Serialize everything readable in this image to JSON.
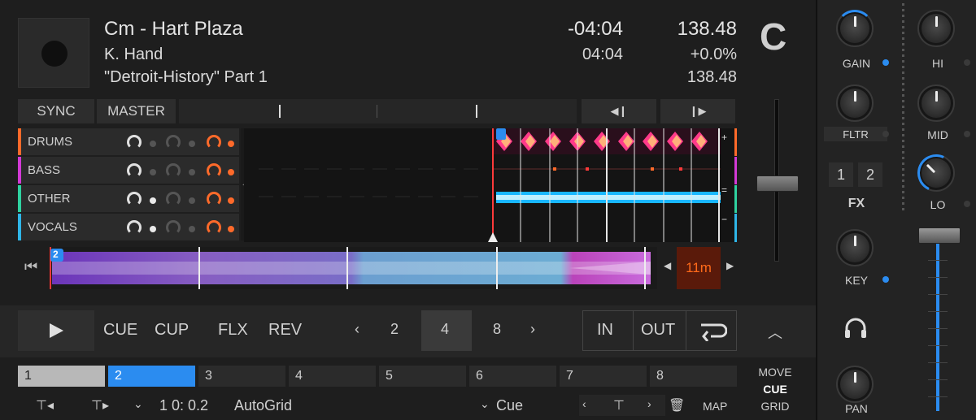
{
  "track": {
    "title": "Cm - Hart Plaza",
    "artist": "K. Hand",
    "album": "\"Detroit-History\" Part 1",
    "remaining": "-04:04",
    "length": "04:04",
    "bpm": "138.48",
    "pitch": "+0.0%",
    "bpm_base": "138.48",
    "deck_letter": "C"
  },
  "sync_row": {
    "sync": "SYNC",
    "master": "MASTER"
  },
  "stems": [
    {
      "label": "DRUMS",
      "color": "#ff6a2a"
    },
    {
      "label": "BASS",
      "color": "#d33ad6"
    },
    {
      "label": "OTHER",
      "color": "#2fd2a0"
    },
    {
      "label": "VOCALS",
      "color": "#2fb6e8"
    }
  ],
  "overview": {
    "cue_marker": "2",
    "time_remaining": "11m"
  },
  "transport": {
    "cue": "CUE",
    "cup": "CUP",
    "flx": "FLX",
    "rev": "REV",
    "beats": [
      "2",
      "4",
      "8"
    ],
    "selected_beat": "4",
    "loop_in": "IN",
    "loop_out": "OUT"
  },
  "hotcues": [
    "1",
    "2",
    "3",
    "4",
    "5",
    "6",
    "7",
    "8"
  ],
  "bottom": {
    "grid_value": "1 0: 0.2",
    "autogrid": "AutoGrid",
    "cue_type": "Cue",
    "map": "MAP"
  },
  "side_labels": {
    "move": "MOVE",
    "cue": "CUE",
    "grid": "GRID"
  },
  "mixer": {
    "gain": "GAIN",
    "hi": "HI",
    "fltr": "FLTR",
    "mid": "MID",
    "fx": "FX",
    "fx1": "1",
    "fx2": "2",
    "lo": "LO",
    "key": "KEY",
    "pan": "PAN"
  },
  "colors": {
    "accent": "#2b8cf0",
    "orange": "#ff6a2a",
    "wave_cyan": "#19b7ff"
  }
}
